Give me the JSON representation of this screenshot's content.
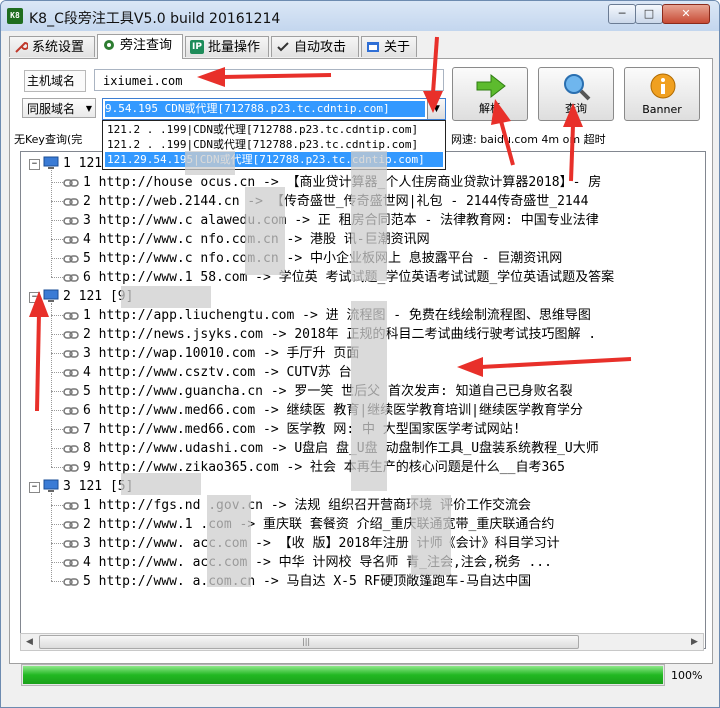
{
  "window": {
    "title": "K8_C段旁注工具V5.0  build 20161214",
    "icon_text": "K8",
    "min_label": "─",
    "max_label": "□",
    "close_label": "✕"
  },
  "tabs": [
    {
      "label": "系统设置",
      "icon": "wrench-icon",
      "color": "#c0392b"
    },
    {
      "label": "旁注查询",
      "icon": "gear-icon",
      "color": "#2e7d32"
    },
    {
      "label": "批量操作",
      "icon": "ip-icon",
      "color": "#1e8c5a"
    },
    {
      "label": "自动攻击",
      "icon": "checklist-icon",
      "color": "#333333"
    },
    {
      "label": "关于",
      "icon": "info-window-icon",
      "color": "#2f6fd6"
    }
  ],
  "query": {
    "host_label": "主机域名",
    "host_value": "ixiumei.com",
    "same_label": "同服域名",
    "ip_value": "9.54.195 CDN或代理[712788.p23.tc.cdntip.com]",
    "dropdown": [
      "121.2  .   .199|CDN或代理[712788.p23.tc.cdntip.com]",
      "121.2  .   .199|CDN或代理[712788.p23.tc.cdntip.com]",
      "121.29.54.195|CDN或代理[712788.p23.tc.cdntip.com]"
    ],
    "resolve_label": "解析",
    "query_label": "查询",
    "banner_label": "Banner",
    "status_left": "无Key查询(完",
    "status_right": "网速: baidu.com 4m   om 超时"
  },
  "tree": {
    "groups": [
      {
        "label": "1  121.29.54.199",
        "items": [
          "1  http://house  ocus.cn -> 【商业贷计算器_个人住房商业贷款计算器2018】- 房",
          "2  http://web.2144.cn -> 【传奇盛世_传奇盛世网|礼包 - 2144传奇盛世_2144",
          "3  http://www.c  alawedu.com -> 正  租房合同范本 - 法律教育网: 中国专业法律",
          "4  http://www.c  nfo.com.cn -> 港股  讯-巨潮资讯网",
          "5  http://www.c  nfo.com.cn -> 中小企业板网上  息披露平台 - 巨潮资讯网",
          "6  http://www.1  58.com -> 学位英  考试试题_学位英语考试试题_学位英语试题及答案"
        ]
      },
      {
        "label": "2  121              [9]",
        "items": [
          "1  http://app.liuchengtu.com -> 进  流程图 - 免费在线绘制流程图、思维导图",
          "2  http://news.jsyks.com -> 2018年  正规的科目二考试曲线行驶考试技巧图解 .",
          "3  http://wap.10010.com -> 手厅升  页面",
          "4  http://www.csztv.com -> CUTV苏  台",
          "5  http://www.guancha.cn -> 罗一笑  世后父  首次发声: 知道自己已身败名裂",
          "6  http://www.med66.com -> 继续医  教育|继续医学教育培训|继续医学教育学分",
          "7  http://www.med66.com -> 医学教  网: 中  大型国家医学考试网站!",
          "8  http://www.udashi.com -> U盘启  盘_U盘  动盘制作工具_U盘装系统教程_U大师",
          "9  http://www.zikao365.com -> 社会  本再生产的核心问题是什么__自考365"
        ]
      },
      {
        "label": "3  121           [5]",
        "items": [
          "1  http://fgs.nd  .gov.cn -> 法规  组织召开营商环境  评价工作交流会",
          "2  http://www.1  .com -> 重庆联  套餐资  介绍_重庆联通宽带_重庆联通合约",
          "3  http://www.   acc.com -> 【收  版】2018年注册  计师《会计》科目学习计",
          "4  http://www.   acc.com -> 中华  计网校  导名师  青_注会,注会,税务 ...",
          "5  http://www.   a.com.cn -> 马自达  X-5 RF硬顶敞篷跑车-马自达中国"
        ]
      }
    ]
  },
  "scroll": {
    "left": "◀",
    "right": "▶",
    "grip": "|||"
  },
  "progress": {
    "value": 1.0,
    "label": "100%"
  },
  "colors": {
    "progress": "#22b822",
    "selection": "#3399ff",
    "arrow": "#e8302a"
  }
}
